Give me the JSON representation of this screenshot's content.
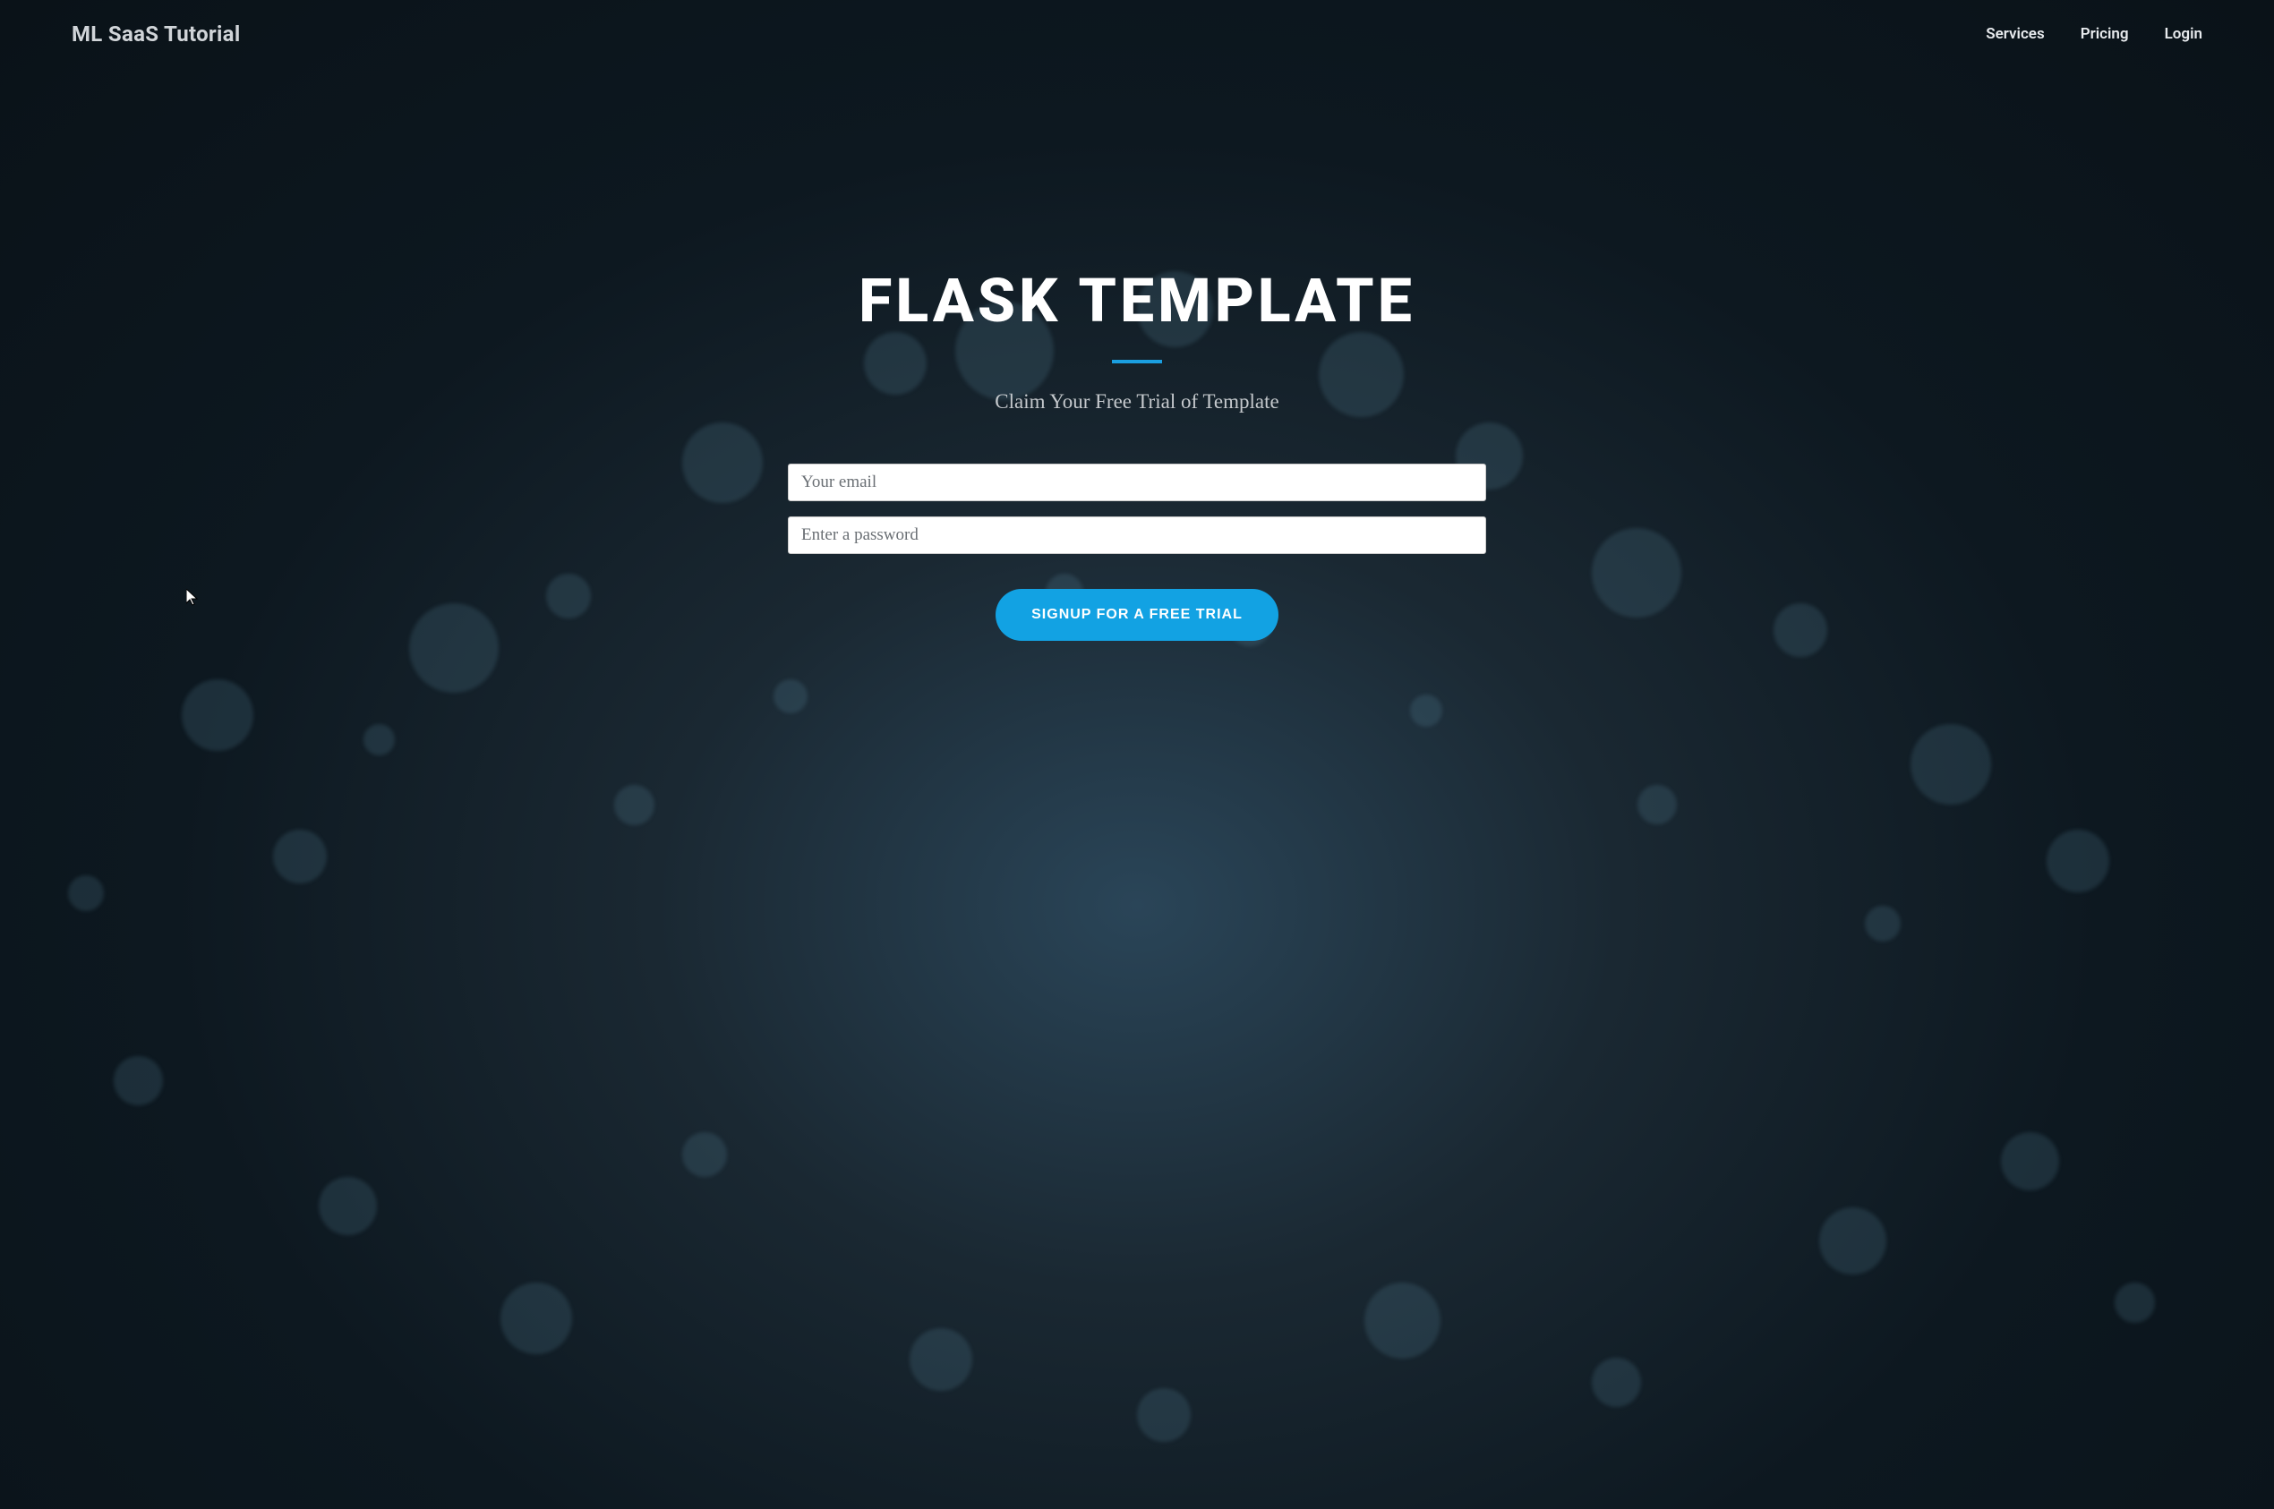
{
  "nav": {
    "brand": "ML SaaS Tutorial",
    "links": [
      {
        "label": "Services"
      },
      {
        "label": "Pricing"
      },
      {
        "label": "Login"
      }
    ]
  },
  "hero": {
    "title": "FLASK TEMPLATE",
    "subtitle": "Claim Your Free Trial of Template"
  },
  "form": {
    "email_placeholder": "Your email",
    "password_placeholder": "Enter a password",
    "submit_label": "SIGNUP FOR A FREE TRIAL"
  }
}
